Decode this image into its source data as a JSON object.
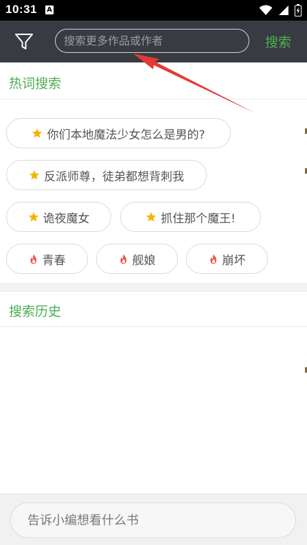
{
  "status_bar": {
    "time": "10:31",
    "notification_icon_letter": "A",
    "icons": [
      "a-notification-icon",
      "wifi-icon",
      "signal-icon",
      "battery-icon"
    ]
  },
  "toolbar": {
    "background": "#383c42",
    "filter_icon": "filter-icon",
    "search_placeholder": "搜索更多作品或作者",
    "search_value": "",
    "search_button_label": "搜索",
    "accent_color": "#4caf50"
  },
  "hot_search": {
    "title": "热词搜索",
    "tags": [
      {
        "label": "你们本地魔法少女怎么是男的?",
        "icon": "star-icon"
      },
      {
        "label": "反派师尊，徒弟都想背刺我",
        "icon": "star-icon"
      },
      {
        "label": "诡夜魔女",
        "icon": "star-icon"
      },
      {
        "label": "抓住那个魔王!",
        "icon": "star-icon"
      },
      {
        "label": "青春",
        "icon": "fire-icon"
      },
      {
        "label": "舰娘",
        "icon": "fire-icon"
      },
      {
        "label": "崩坏",
        "icon": "fire-icon"
      }
    ]
  },
  "history": {
    "title": "搜索历史",
    "items": []
  },
  "bottom_bar": {
    "wish_placeholder": "告诉小编想看什么书",
    "wish_value": ""
  },
  "colors": {
    "star": "#f5b400",
    "fire": "#f0564a",
    "annotation_arrow": "#e53935"
  }
}
